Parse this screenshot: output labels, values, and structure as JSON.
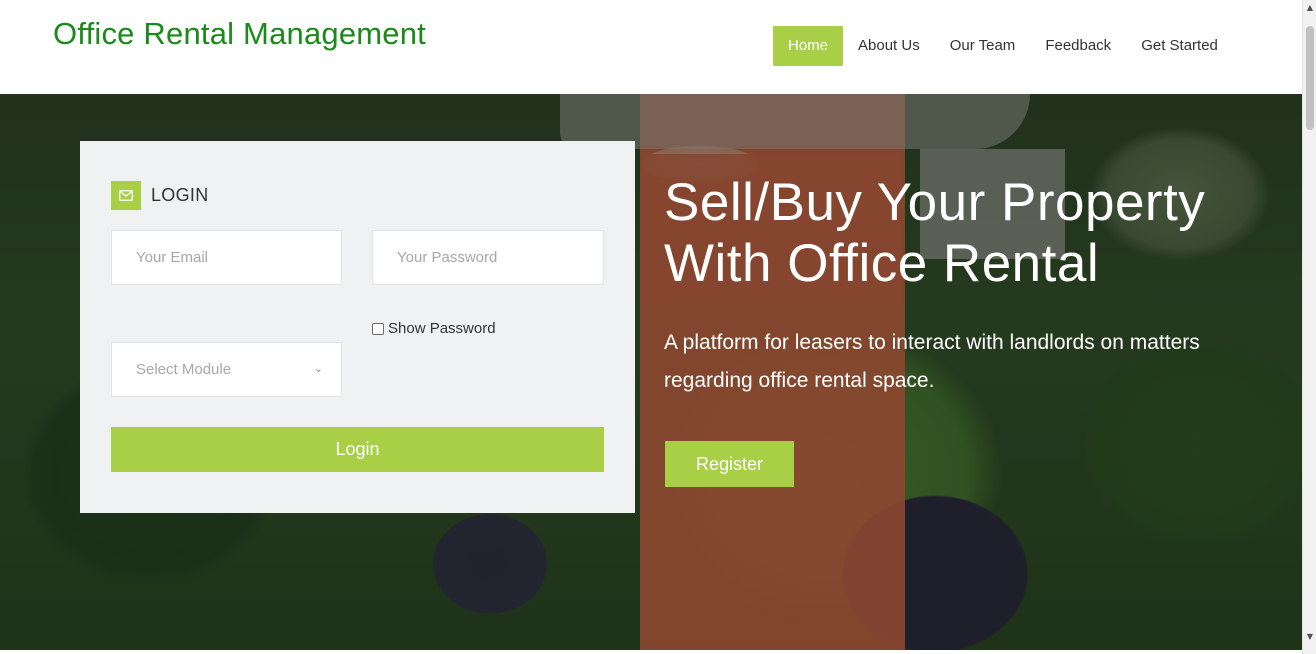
{
  "header": {
    "brand": "Office Rental Management",
    "nav": [
      {
        "label": "Home",
        "active": true
      },
      {
        "label": "About Us",
        "active": false
      },
      {
        "label": "Our Team",
        "active": false
      },
      {
        "label": "Feedback",
        "active": false
      },
      {
        "label": "Get Started",
        "active": false
      }
    ]
  },
  "login": {
    "title": "LOGIN",
    "email_placeholder": "Your Email",
    "password_placeholder": "Your Password",
    "show_password_label": "Show Password",
    "module_select": "Select Module",
    "submit_label": "Login"
  },
  "hero": {
    "title": "Sell/Buy Your Property With Office Rental",
    "subtitle": "A platform for leasers to interact with landlords on matters regarding office rental space.",
    "register_label": "Register"
  },
  "colors": {
    "accent": "#a8cf45",
    "brand": "#1a8a1a"
  },
  "icons": {
    "login_icon": "envelope-icon",
    "select_icon": "chevron-down-icon"
  }
}
